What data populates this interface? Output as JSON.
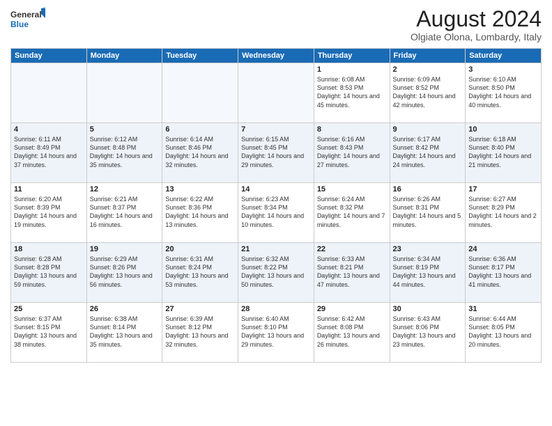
{
  "logo": {
    "general": "General",
    "blue": "Blue"
  },
  "title": "August 2024",
  "subtitle": "Olgiate Olona, Lombardy, Italy",
  "days_of_week": [
    "Sunday",
    "Monday",
    "Tuesday",
    "Wednesday",
    "Thursday",
    "Friday",
    "Saturday"
  ],
  "weeks": [
    [
      {
        "day": "",
        "content": ""
      },
      {
        "day": "",
        "content": ""
      },
      {
        "day": "",
        "content": ""
      },
      {
        "day": "",
        "content": ""
      },
      {
        "day": "1",
        "content": "Sunrise: 6:08 AM\nSunset: 8:53 PM\nDaylight: 14 hours and 45 minutes."
      },
      {
        "day": "2",
        "content": "Sunrise: 6:09 AM\nSunset: 8:52 PM\nDaylight: 14 hours and 42 minutes."
      },
      {
        "day": "3",
        "content": "Sunrise: 6:10 AM\nSunset: 8:50 PM\nDaylight: 14 hours and 40 minutes."
      }
    ],
    [
      {
        "day": "4",
        "content": "Sunrise: 6:11 AM\nSunset: 8:49 PM\nDaylight: 14 hours and 37 minutes."
      },
      {
        "day": "5",
        "content": "Sunrise: 6:12 AM\nSunset: 8:48 PM\nDaylight: 14 hours and 35 minutes."
      },
      {
        "day": "6",
        "content": "Sunrise: 6:14 AM\nSunset: 8:46 PM\nDaylight: 14 hours and 32 minutes."
      },
      {
        "day": "7",
        "content": "Sunrise: 6:15 AM\nSunset: 8:45 PM\nDaylight: 14 hours and 29 minutes."
      },
      {
        "day": "8",
        "content": "Sunrise: 6:16 AM\nSunset: 8:43 PM\nDaylight: 14 hours and 27 minutes."
      },
      {
        "day": "9",
        "content": "Sunrise: 6:17 AM\nSunset: 8:42 PM\nDaylight: 14 hours and 24 minutes."
      },
      {
        "day": "10",
        "content": "Sunrise: 6:18 AM\nSunset: 8:40 PM\nDaylight: 14 hours and 21 minutes."
      }
    ],
    [
      {
        "day": "11",
        "content": "Sunrise: 6:20 AM\nSunset: 8:39 PM\nDaylight: 14 hours and 19 minutes."
      },
      {
        "day": "12",
        "content": "Sunrise: 6:21 AM\nSunset: 8:37 PM\nDaylight: 14 hours and 16 minutes."
      },
      {
        "day": "13",
        "content": "Sunrise: 6:22 AM\nSunset: 8:36 PM\nDaylight: 14 hours and 13 minutes."
      },
      {
        "day": "14",
        "content": "Sunrise: 6:23 AM\nSunset: 8:34 PM\nDaylight: 14 hours and 10 minutes."
      },
      {
        "day": "15",
        "content": "Sunrise: 6:24 AM\nSunset: 8:32 PM\nDaylight: 14 hours and 7 minutes."
      },
      {
        "day": "16",
        "content": "Sunrise: 6:26 AM\nSunset: 8:31 PM\nDaylight: 14 hours and 5 minutes."
      },
      {
        "day": "17",
        "content": "Sunrise: 6:27 AM\nSunset: 8:29 PM\nDaylight: 14 hours and 2 minutes."
      }
    ],
    [
      {
        "day": "18",
        "content": "Sunrise: 6:28 AM\nSunset: 8:28 PM\nDaylight: 13 hours and 59 minutes."
      },
      {
        "day": "19",
        "content": "Sunrise: 6:29 AM\nSunset: 8:26 PM\nDaylight: 13 hours and 56 minutes."
      },
      {
        "day": "20",
        "content": "Sunrise: 6:31 AM\nSunset: 8:24 PM\nDaylight: 13 hours and 53 minutes."
      },
      {
        "day": "21",
        "content": "Sunrise: 6:32 AM\nSunset: 8:22 PM\nDaylight: 13 hours and 50 minutes."
      },
      {
        "day": "22",
        "content": "Sunrise: 6:33 AM\nSunset: 8:21 PM\nDaylight: 13 hours and 47 minutes."
      },
      {
        "day": "23",
        "content": "Sunrise: 6:34 AM\nSunset: 8:19 PM\nDaylight: 13 hours and 44 minutes."
      },
      {
        "day": "24",
        "content": "Sunrise: 6:36 AM\nSunset: 8:17 PM\nDaylight: 13 hours and 41 minutes."
      }
    ],
    [
      {
        "day": "25",
        "content": "Sunrise: 6:37 AM\nSunset: 8:15 PM\nDaylight: 13 hours and 38 minutes."
      },
      {
        "day": "26",
        "content": "Sunrise: 6:38 AM\nSunset: 8:14 PM\nDaylight: 13 hours and 35 minutes."
      },
      {
        "day": "27",
        "content": "Sunrise: 6:39 AM\nSunset: 8:12 PM\nDaylight: 13 hours and 32 minutes."
      },
      {
        "day": "28",
        "content": "Sunrise: 6:40 AM\nSunset: 8:10 PM\nDaylight: 13 hours and 29 minutes."
      },
      {
        "day": "29",
        "content": "Sunrise: 6:42 AM\nSunset: 8:08 PM\nDaylight: 13 hours and 26 minutes."
      },
      {
        "day": "30",
        "content": "Sunrise: 6:43 AM\nSunset: 8:06 PM\nDaylight: 13 hours and 23 minutes."
      },
      {
        "day": "31",
        "content": "Sunrise: 6:44 AM\nSunset: 8:05 PM\nDaylight: 13 hours and 20 minutes."
      }
    ]
  ]
}
